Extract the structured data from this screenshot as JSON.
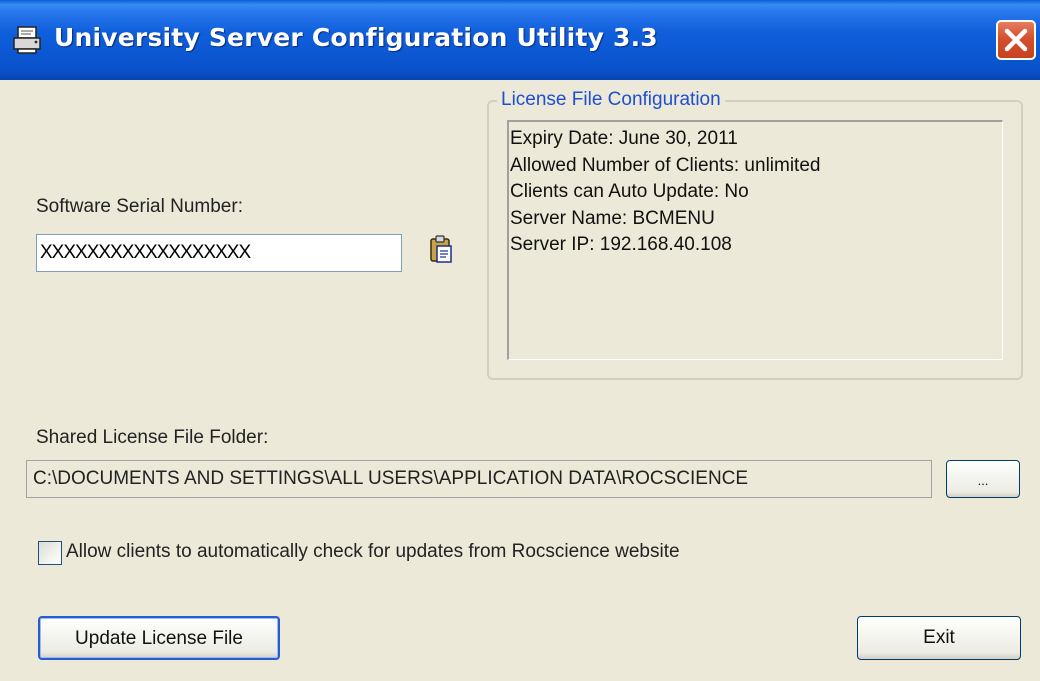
{
  "window": {
    "title": "University Server Configuration Utility 3.3"
  },
  "serial": {
    "label": "Software Serial Number:",
    "value": "XXXXXXXXXXXXXXXXXX"
  },
  "license_group": {
    "legend": "License File Configuration",
    "lines": [
      "Expiry Date: June 30, 2011",
      "Allowed Number of Clients: unlimited",
      "Clients can Auto Update: No",
      "Server Name: BCMENU",
      "Server IP: 192.168.40.108"
    ]
  },
  "shared_folder": {
    "label": "Shared License File Folder:",
    "path": "C:\\DOCUMENTS AND SETTINGS\\ALL USERS\\APPLICATION DATA\\ROCSCIENCE",
    "browse_label": "..."
  },
  "auto_update": {
    "label": "Allow clients to automatically check for updates from Rocscience website",
    "checked": false
  },
  "buttons": {
    "update": "Update License File",
    "exit": "Exit"
  },
  "colors": {
    "titlebar": "#0a57d2",
    "group_legend": "#1f4fd1",
    "close_button": "#d6502f",
    "dialog_bg": "#ece9d8"
  },
  "icons": {
    "app": "printer-icon",
    "close": "close-icon",
    "paste": "clipboard-paste-icon"
  }
}
